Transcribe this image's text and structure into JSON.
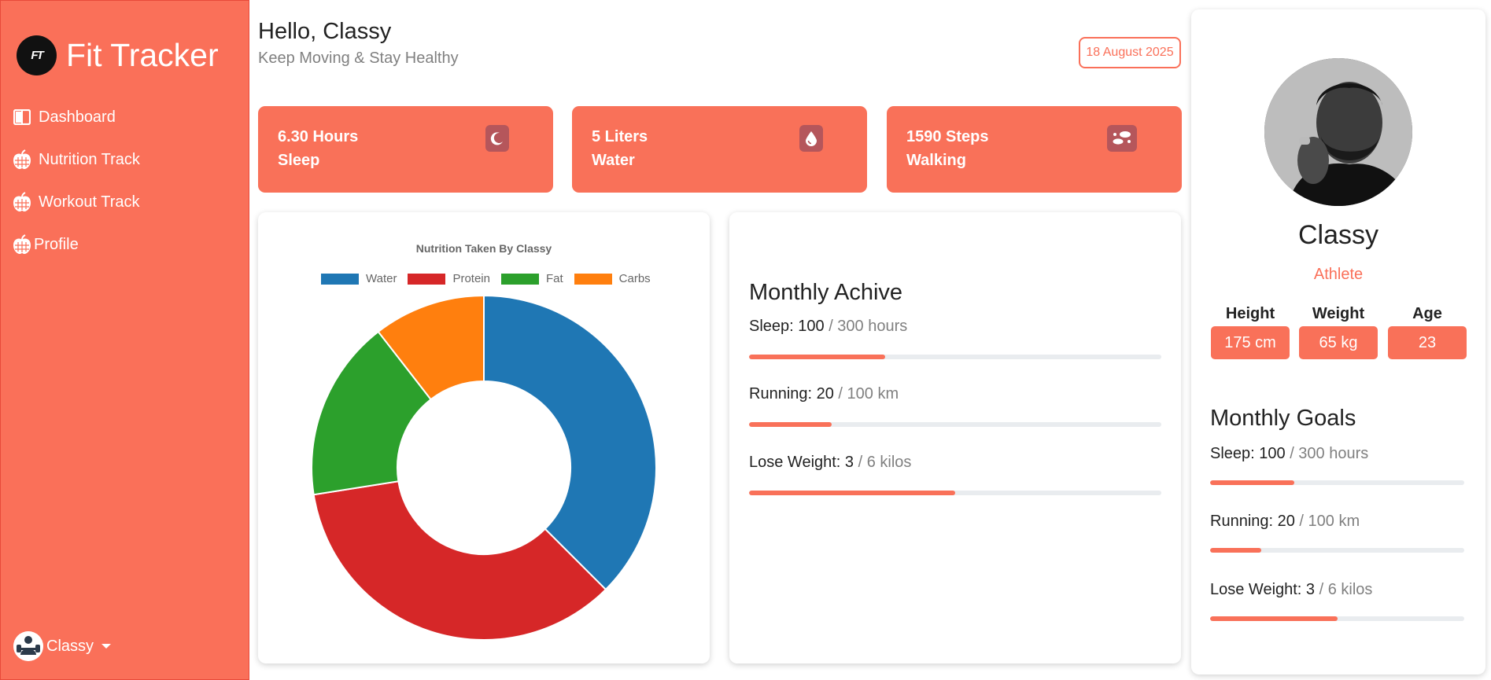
{
  "app": {
    "title": "Fit Tracker",
    "logo_text": "FT"
  },
  "sidebar": {
    "items": [
      {
        "label": "Dashboard",
        "icon": "layout-icon"
      },
      {
        "label": "Nutrition Track",
        "icon": "apple-icon"
      },
      {
        "label": "Workout Track",
        "icon": "apple-icon"
      },
      {
        "label": "Profile",
        "icon": "apple-icon"
      }
    ],
    "user": {
      "name": "Classy"
    }
  },
  "header": {
    "greeting": "Hello, Classy",
    "tagline": "Keep Moving & Stay Healthy",
    "date": "18 August 2025"
  },
  "stats": [
    {
      "value": "6.30 Hours",
      "label": "Sleep",
      "icon": "moon-icon"
    },
    {
      "value": "5 Liters",
      "label": "Water",
      "icon": "water-drop-icon"
    },
    {
      "value": "1590 Steps",
      "label": "Walking",
      "icon": "footprints-icon"
    }
  ],
  "chart_data": {
    "type": "pie",
    "title": "Nutrition Taken By Classy",
    "categories": [
      "Water",
      "Protein",
      "Fat",
      "Carbs"
    ],
    "values": [
      37.5,
      35,
      17,
      10.5
    ],
    "colors": [
      "#1f77b4",
      "#d62728",
      "#2ca02c",
      "#ff7f0e"
    ],
    "legend": "top",
    "donut": true
  },
  "achive": {
    "title": "Monthly Achive",
    "items": [
      {
        "label": "Sleep: 100",
        "unit": " / 300 hours",
        "progress": 0.33
      },
      {
        "label": "Running: 20",
        "unit": " / 100 km",
        "progress": 0.2
      },
      {
        "label": "Lose Weight: 3",
        "unit": " / 6 kilos",
        "progress": 0.5
      }
    ]
  },
  "profile": {
    "name": "Classy",
    "role": "Athlete",
    "metrics": [
      {
        "label": "Height",
        "value": "175 cm"
      },
      {
        "label": "Weight",
        "value": "65 kg"
      },
      {
        "label": "Age",
        "value": "23"
      }
    ],
    "goals_title": "Monthly Goals",
    "goals": [
      {
        "label": "Sleep: 100",
        "unit": " / 300 hours",
        "progress": 0.33
      },
      {
        "label": "Running: 20",
        "unit": " / 100 km",
        "progress": 0.2
      },
      {
        "label": "Lose Weight: 3",
        "unit": " / 6 kilos",
        "progress": 0.5
      }
    ]
  },
  "colors": {
    "accent": "#fa7059",
    "card_icon_bg": "#b5565b",
    "track": "#e9ecef"
  }
}
